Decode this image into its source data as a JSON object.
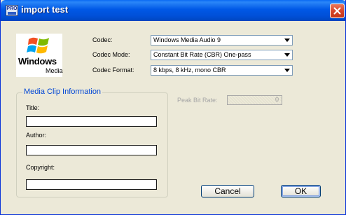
{
  "window": {
    "title": "import test",
    "app_icon_text": "PRO"
  },
  "logo": {
    "word": "Windows",
    "sub": "Media"
  },
  "codec": {
    "label": "Codec:",
    "value": "Windows Media Audio 9"
  },
  "codec_mode": {
    "label": "Codec Mode:",
    "value": "Constant Bit Rate (CBR) One-pass"
  },
  "codec_format": {
    "label": "Codec Format:",
    "value": "8 kbps,  8 kHz, mono CBR"
  },
  "media_clip": {
    "group_title": "Media Clip Information",
    "title_label": "Title:",
    "title_value": "",
    "author_label": "Author:",
    "author_value": "",
    "copyright_label": "Copyright:",
    "copyright_value": ""
  },
  "peak_bit_rate": {
    "label": "Peak Bit Rate:",
    "value": "0"
  },
  "buttons": {
    "cancel": "Cancel",
    "ok": "OK"
  },
  "colors": {
    "titlebar": "#0058E6",
    "close_button": "#D8452A",
    "group_title": "#0046D5",
    "dialog_background": "#ECE9D8"
  },
  "icons": [
    "app-icon",
    "close-icon",
    "windows-flag-icon",
    "dropdown-arrow-icon"
  ]
}
